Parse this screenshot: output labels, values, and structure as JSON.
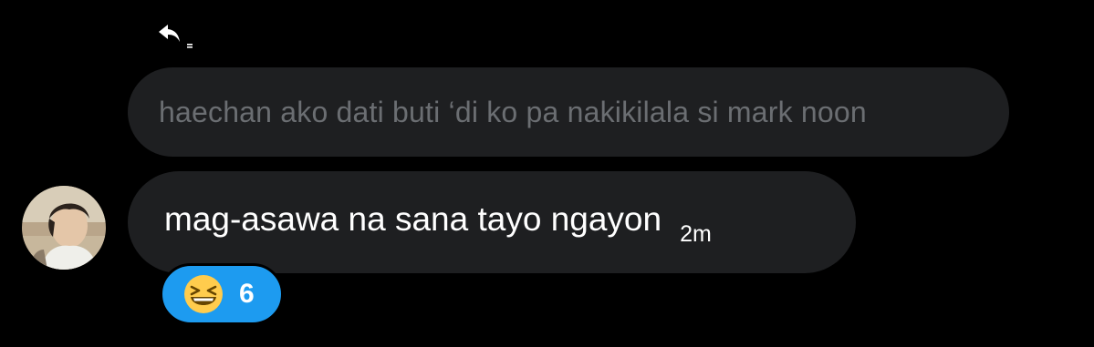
{
  "reply": {
    "icon": "reply-arrow-icon"
  },
  "quoted_message": {
    "text": "haechan ako dati buti ‘di ko pa nakikilala si mark noon"
  },
  "message": {
    "text": "mag-asawa na sana tayo ngayon",
    "timestamp": "2m",
    "avatar": "user-avatar"
  },
  "reaction": {
    "emoji_icon": "grinning-squinting-face-icon",
    "count": "6"
  },
  "colors": {
    "background": "#000000",
    "bubble": "#1e1f21",
    "quoted_text": "#6b6e72",
    "accent": "#1d9bf0"
  }
}
